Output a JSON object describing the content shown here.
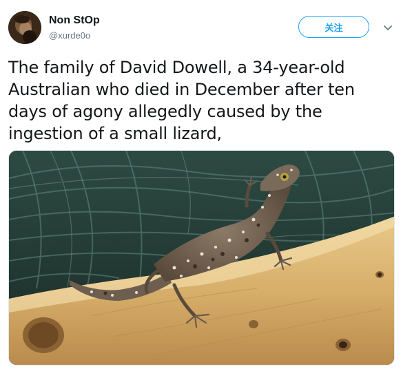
{
  "user": {
    "display_name": "Non StOp",
    "handle": "@xurde0o"
  },
  "actions": {
    "follow_label": "关注",
    "more_icon": "chevron-down-icon"
  },
  "tweet": {
    "text": "The family of David Dowell, a 34-year-old Australian who died in December after ten days of agony allegedly caused by the ingestion of a small lizard,"
  },
  "colors": {
    "accent": "#1da1f2",
    "text": "#14171a",
    "secondary": "#657786"
  }
}
